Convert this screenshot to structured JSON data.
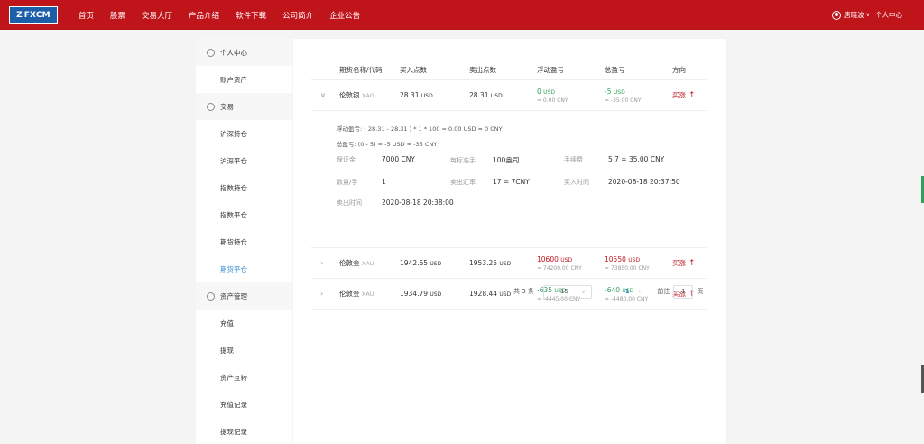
{
  "brand": {
    "mark": "Z",
    "name": "FXCM"
  },
  "nav": [
    "首页",
    "股票",
    "交易大厅",
    "产品介绍",
    "软件下载",
    "公司简介",
    "企业公告"
  ],
  "user": {
    "name": "唐晓波",
    "center": "个人中心"
  },
  "sidebar": {
    "group1": {
      "icon": "◎",
      "label": "个人中心",
      "items": [
        "账户资产"
      ]
    },
    "group2": {
      "icon": "◎",
      "label": "交易",
      "items": [
        "沪深持仓",
        "沪深平仓",
        "指数持仓",
        "指数平仓",
        "期货持仓",
        "期货平仓"
      ],
      "active": "期货平仓"
    },
    "group3": {
      "icon": "◎",
      "label": "资产管理",
      "items": [
        "充值",
        "提现",
        "资产互转",
        "充值记录",
        "提现记录"
      ]
    }
  },
  "table": {
    "headers": [
      "期货名称/代码",
      "买入点数",
      "卖出点数",
      "浮动盈亏",
      "总盈亏",
      "方向"
    ],
    "rows": [
      {
        "name": "伦敦银",
        "code": "XAG",
        "buy": "28.31",
        "sell": "28.31",
        "unit": "USD",
        "float": "0",
        "float_cny": "≈ 0.00 CNY",
        "total": "-5",
        "total_cny": "≈ -35.00 CNY",
        "direction": "买涨",
        "expanded": true
      },
      {
        "name": "伦敦金",
        "code": "XAU",
        "buy": "1942.65",
        "sell": "1953.25",
        "unit": "USD",
        "float": "10600",
        "float_cny": "≈ 74200.00 CNY",
        "total": "10550",
        "total_cny": "≈ 73850.00 CNY",
        "direction": "买涨",
        "expanded": false
      },
      {
        "name": "伦敦金",
        "code": "XAU",
        "buy": "1934.79",
        "sell": "1928.44",
        "unit": "USD",
        "float": "-635",
        "float_cny": "≈ -4445.00 CNY",
        "total": "-640",
        "total_cny": "≈ -4480.00 CNY",
        "direction": "买涨",
        "expanded": false
      }
    ],
    "detail": {
      "formula1": "浮动盈亏: ( 28.31 - 28.31 ) * 1 * 100 = 0.00 USD ≈ 0 CNY",
      "formula2": "总盈亏: (0 - 5) = -5 USD ≈ -35 CNY",
      "deposit_k": "保证金",
      "deposit_v": "7000 CNY",
      "lot_k": "每标准手",
      "lot_v": "100盎司",
      "fee_k": "手续费",
      "fee_v": "5 7 = 35.00 CNY",
      "qty_k": "数量/手",
      "qty_v": "1",
      "rate_k": "卖出汇率",
      "rate_v": "17 = 7CNY",
      "buytime_k": "买入时间",
      "buytime_v": "2020-08-18 20:37:50",
      "selltime_k": "卖出时间",
      "selltime_v": "2020-08-18 20:38:00"
    }
  },
  "pager": {
    "total": "共 3 条",
    "size": "15",
    "prev": "‹",
    "page": "1",
    "next": "›",
    "goto": "前往",
    "goto_value": "1",
    "page_unit": "页"
  }
}
